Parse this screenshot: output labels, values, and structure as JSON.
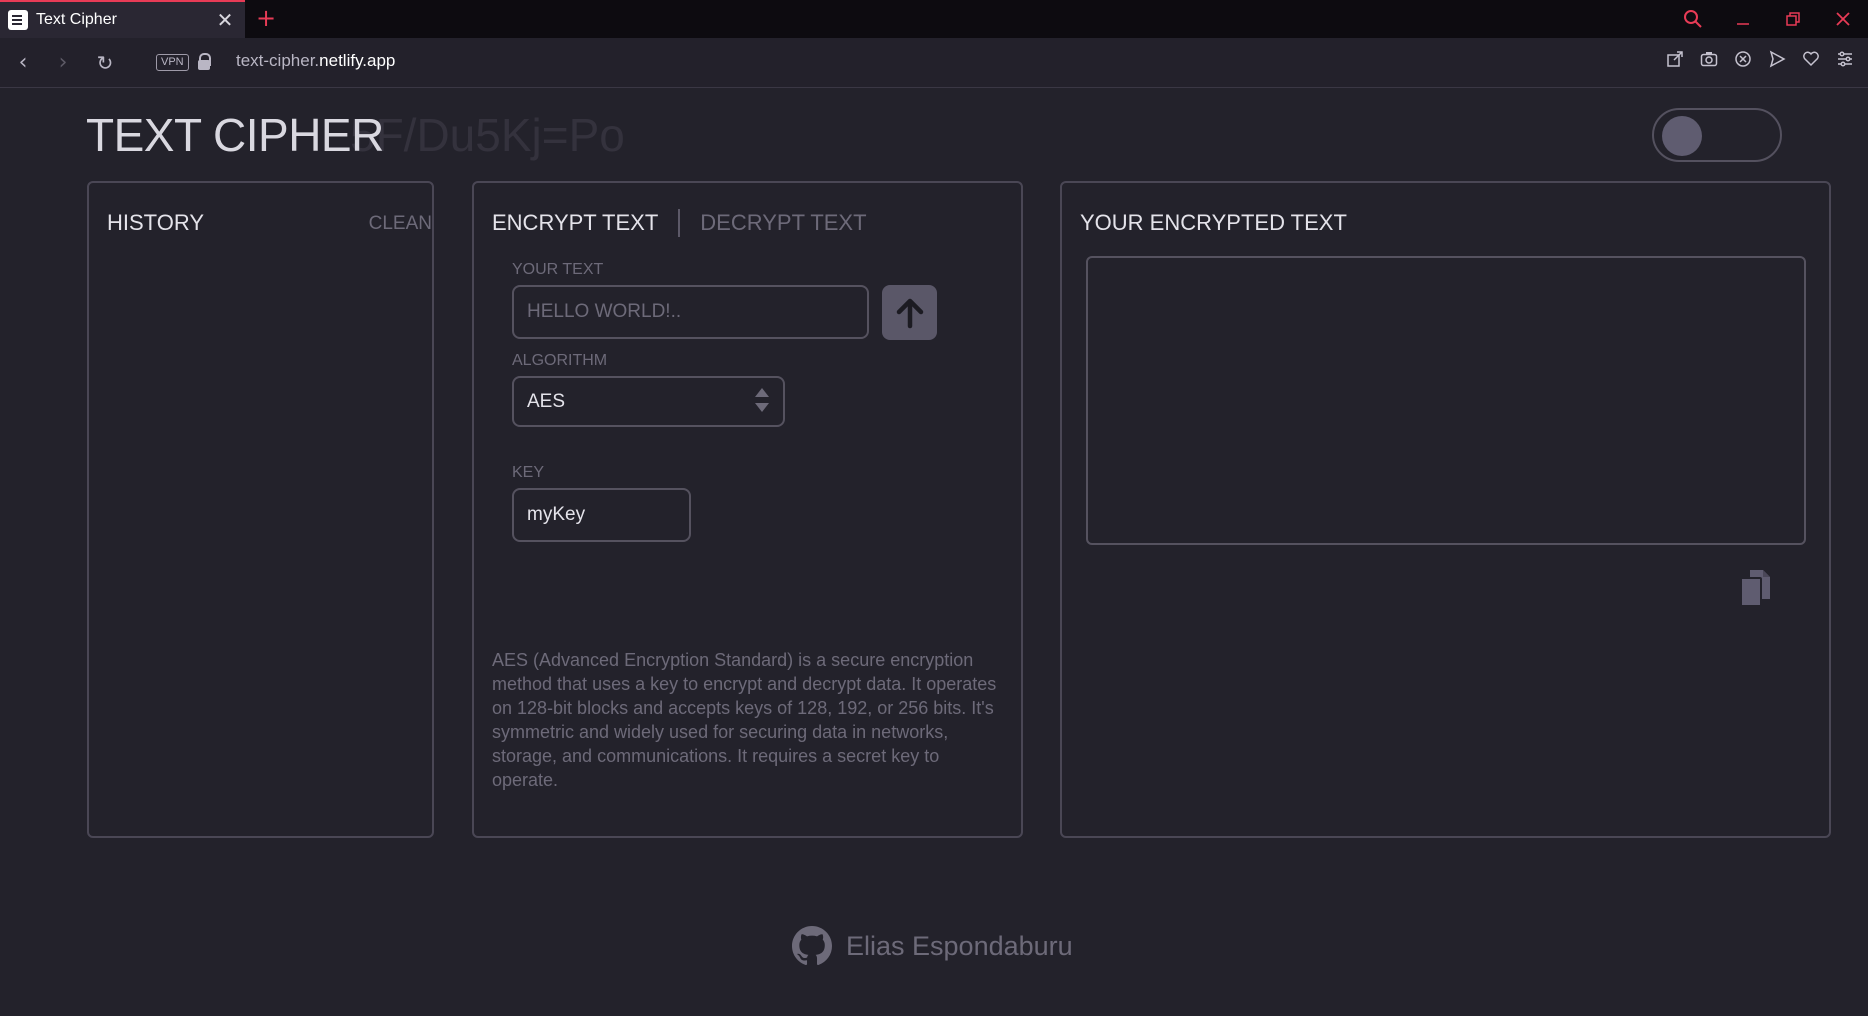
{
  "browser": {
    "tab_title": "Text Cipher",
    "url_prefix": "text-cipher.",
    "url_host": "netlify.app",
    "vpn_label": "VPN",
    "accent_color": "#e83b56"
  },
  "header": {
    "title": "TEXT CIPHER",
    "title_ghost": "5F/Du5Kj=Po"
  },
  "history": {
    "heading": "HISTORY",
    "clean_label": "CLEAN"
  },
  "encrypt": {
    "tab_encrypt": "ENCRYPT TEXT",
    "tab_decrypt": "DECRYPT TEXT",
    "text_label": "YOUR TEXT",
    "text_placeholder": "HELLO WORLD!..",
    "algorithm_label": "ALGORITHM",
    "algorithm_value": "AES",
    "key_label": "KEY",
    "key_value": "myKey",
    "description": "AES (Advanced Encryption Standard) is a secure encryption method that uses a key to encrypt and decrypt data. It operates on 128-bit blocks and accepts keys of 128, 192, or 256 bits. It's symmetric and widely used for securing data in networks, storage, and communications. It requires a secret key to operate."
  },
  "output": {
    "heading": "YOUR ENCRYPTED TEXT",
    "value": ""
  },
  "footer": {
    "author": "Elias Espondaburu"
  }
}
